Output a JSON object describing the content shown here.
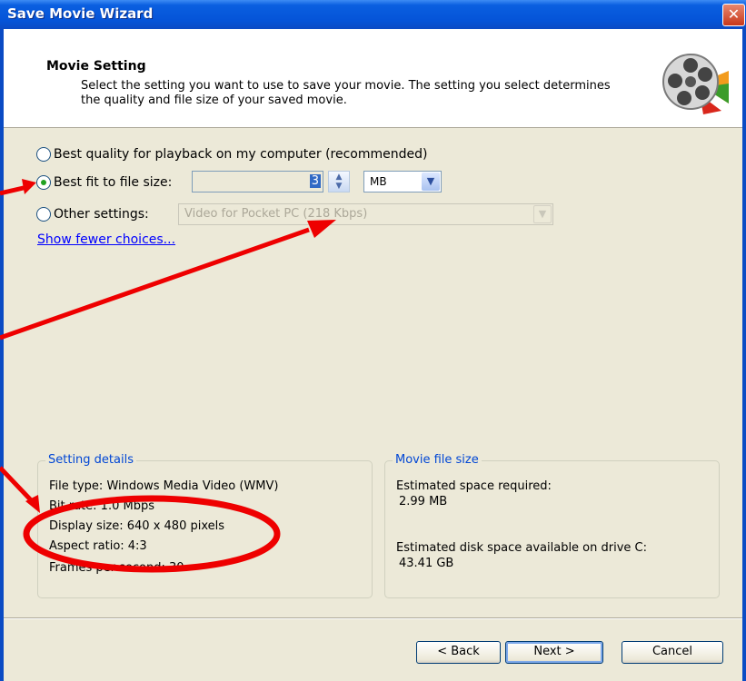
{
  "window": {
    "title": "Save Movie Wizard",
    "close_glyph": "✕"
  },
  "header": {
    "title": "Movie Setting",
    "description": "Select the setting you want to use to save your movie. The setting you select determines the quality and file size of your saved movie.",
    "icon": "film-reel-icon"
  },
  "options": {
    "best_quality_label": "Best quality for playback on my computer (recommended)",
    "best_fit_label": "Best fit to file size:",
    "best_fit_value": "3",
    "unit_value": "MB",
    "other_label": "Other settings:",
    "other_value": "Video for Pocket PC (218 Kbps)",
    "selected": "best_fit",
    "show_fewer_link": "Show fewer choices..."
  },
  "setting_details": {
    "title": "Setting details",
    "file_type": "File type: Windows Media Video (WMV)",
    "bit_rate": "Bit rate: 1.0 Mbps",
    "display_size": "Display size: 640 x 480 pixels",
    "aspect_ratio": "Aspect ratio: 4:3",
    "fps": "Frames per second: 30"
  },
  "movie_file_size": {
    "title": "Movie file size",
    "estimated_label": "Estimated space required:",
    "estimated_value": "2.99 MB",
    "disk_label": "Estimated disk space available on drive C:",
    "disk_value": "43.41 GB"
  },
  "buttons": {
    "back": "< Back",
    "next": "Next >",
    "cancel": "Cancel"
  },
  "colors": {
    "annotation": "#ee0000",
    "titlebar": "#0554d8",
    "window_bg": "#ece9d8"
  }
}
